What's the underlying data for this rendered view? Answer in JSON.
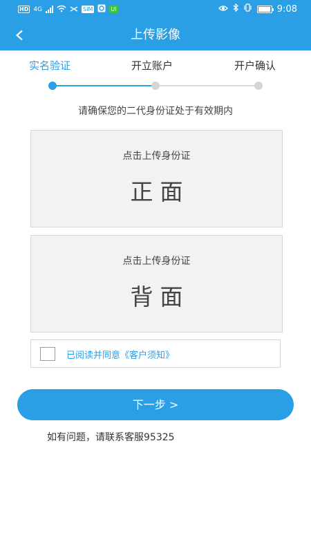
{
  "status_bar": {
    "network": "HD",
    "signal_type": "4G",
    "badge": "SIM",
    "green_badge": "UI",
    "time": "9:08"
  },
  "header": {
    "back_label": "<",
    "title": "上传影像"
  },
  "steps": [
    {
      "label": "实名验证",
      "state": "active"
    },
    {
      "label": "开立账户",
      "state": "pending"
    },
    {
      "label": "开户确认",
      "state": "pending"
    }
  ],
  "hint": "请确保您的二代身份证处于有效期内",
  "upload": {
    "front": {
      "caption": "点击上传身份证",
      "side": "正面"
    },
    "back": {
      "caption": "点击上传身份证",
      "side": "背面"
    }
  },
  "agreement": {
    "checked": false,
    "text": "已阅读并同意《客户须知》"
  },
  "next_button": "下一步 >",
  "contact": "如有问题，请联系客服95325",
  "colors": {
    "accent": "#2a9fe6",
    "card_bg": "#f2f2f2",
    "inactive_dot": "#d4d4d4"
  }
}
